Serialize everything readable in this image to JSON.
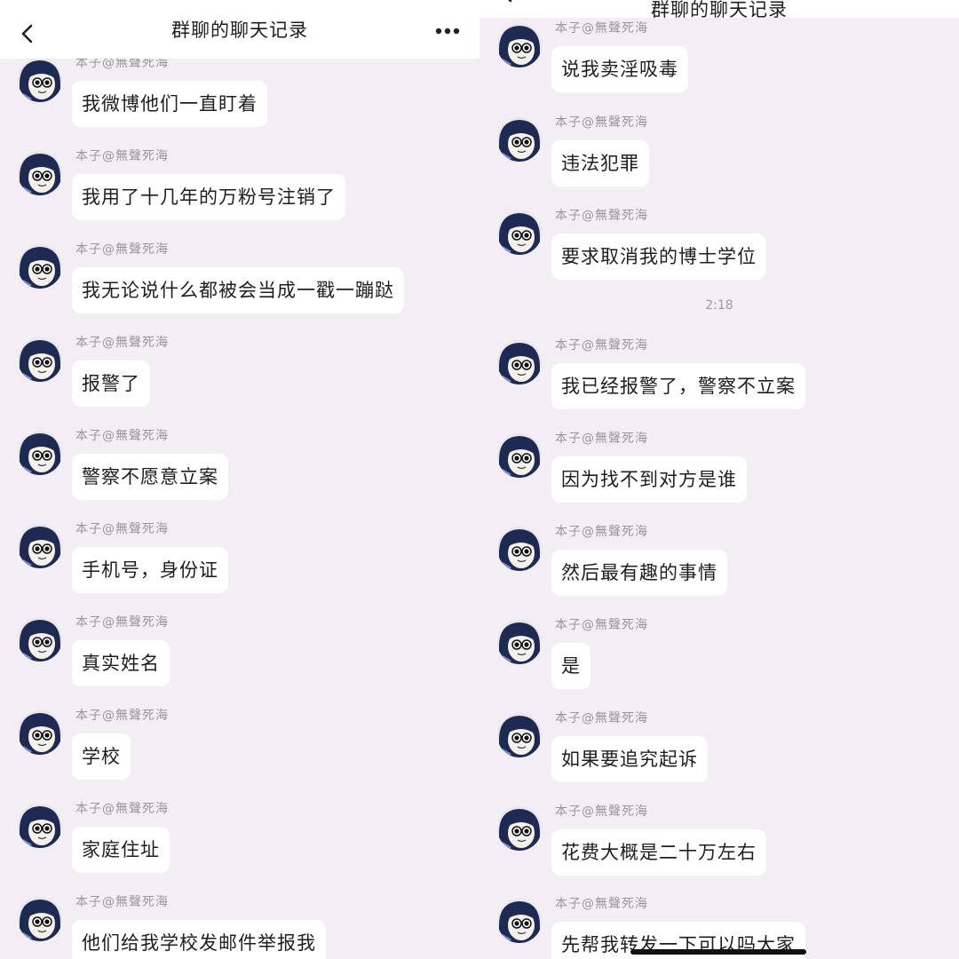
{
  "app": {
    "title": "群聊的聊天记录"
  },
  "colors": {
    "chat_background": "#f3eef4",
    "bubble": "#ffffff",
    "nickname": "#9a959c"
  },
  "icons": {
    "back": "chevron-left-icon",
    "more": "more-horizontal-icon",
    "avatar": "anime-character-avatar"
  },
  "left_panel": {
    "messages": [
      {
        "sender": "本子@無聲死海",
        "text": "我微博他们一直盯着"
      },
      {
        "sender": "本子@無聲死海",
        "text": "我用了十几年的万粉号注销了"
      },
      {
        "sender": "本子@無聲死海",
        "text": "我无论说什么都被会当成一戳一蹦跶"
      },
      {
        "sender": "本子@無聲死海",
        "text": "报警了"
      },
      {
        "sender": "本子@無聲死海",
        "text": "警察不愿意立案"
      },
      {
        "sender": "本子@無聲死海",
        "text": "手机号，身份证"
      },
      {
        "sender": "本子@無聲死海",
        "text": "真实姓名"
      },
      {
        "sender": "本子@無聲死海",
        "text": "学校"
      },
      {
        "sender": "本子@無聲死海",
        "text": "家庭住址"
      },
      {
        "sender": "本子@無聲死海",
        "text": "他们给我学校发邮件举报我"
      }
    ]
  },
  "right_panel": {
    "messages": [
      {
        "sender": "本子@無聲死海",
        "text": "说我卖淫吸毒"
      },
      {
        "sender": "本子@無聲死海",
        "text": "违法犯罪"
      },
      {
        "sender": "本子@無聲死海",
        "text": "要求取消我的博士学位"
      },
      {
        "sender": "本子@無聲死海",
        "text": "我已经报警了，警察不立案"
      },
      {
        "sender": "本子@無聲死海",
        "text": "因为找不到对方是谁"
      },
      {
        "sender": "本子@無聲死海",
        "text": "然后最有趣的事情"
      },
      {
        "sender": "本子@無聲死海",
        "text": "是"
      },
      {
        "sender": "本子@無聲死海",
        "text": "如果要追究起诉"
      },
      {
        "sender": "本子@無聲死海",
        "text": "花费大概是二十万左右"
      },
      {
        "sender": "本子@無聲死海",
        "text": "先帮我转发一下可以吗大家"
      }
    ],
    "timestamp": "2:18"
  }
}
